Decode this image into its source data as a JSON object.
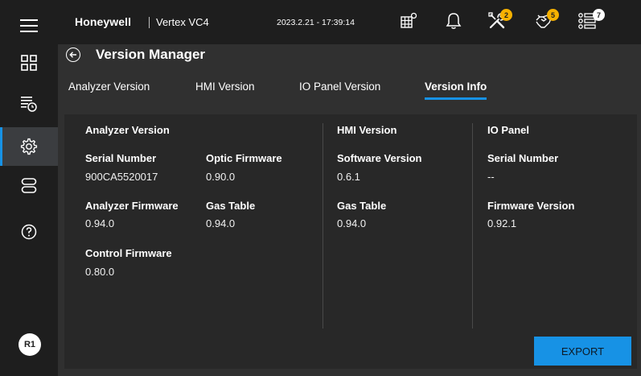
{
  "header": {
    "brand": "Honeywell",
    "product": "Vertex VC4",
    "datetime": "2023.2.21 - 17:39:14",
    "icons": [
      {
        "name": "sensor-grid-icon",
        "badge": ""
      },
      {
        "name": "bell-icon",
        "badge": ""
      },
      {
        "name": "tools-icon",
        "badge": "2"
      },
      {
        "name": "hand-icon",
        "badge": "5"
      },
      {
        "name": "list-icon",
        "badge": "7"
      }
    ]
  },
  "sidebar": {
    "items": [
      {
        "name": "menu-icon",
        "active": false
      },
      {
        "name": "dashboard-icon",
        "active": false
      },
      {
        "name": "schedule-list-icon",
        "active": false
      },
      {
        "name": "settings-icon",
        "active": true
      },
      {
        "name": "storage-icon",
        "active": false
      },
      {
        "name": "help-icon",
        "active": false
      }
    ],
    "user_initials": "R1"
  },
  "page": {
    "title": "Version Manager"
  },
  "tabs": [
    {
      "label": "Analyzer Version",
      "active": false
    },
    {
      "label": "HMI Version",
      "active": false
    },
    {
      "label": "IO Panel Version",
      "active": false
    },
    {
      "label": "Version Info",
      "active": true
    }
  ],
  "analyzer": {
    "title": "Analyzer Version",
    "serial_label": "Serial Number",
    "serial_value": "900CA5520017",
    "optic_label": "Optic Firmware",
    "optic_value": "0.90.0",
    "firmware_label": "Analyzer Firmware",
    "firmware_value": "0.94.0",
    "gas_label": "Gas Table",
    "gas_value": "0.94.0",
    "control_label": "Control Firmware",
    "control_value": "0.80.0"
  },
  "hmi": {
    "title": "HMI Version",
    "software_label": "Software Version",
    "software_value": "0.6.1",
    "gas_label": "Gas Table",
    "gas_value": "0.94.0"
  },
  "io_panel": {
    "title": "IO Panel",
    "serial_label": "Serial Number",
    "serial_value": "--",
    "firmware_label": "Firmware Version",
    "firmware_value": "0.92.1"
  },
  "actions": {
    "export_label": "EXPORT"
  },
  "colors": {
    "accent": "#1792e5",
    "badge": "#f6b100",
    "background": "#1e1e1e",
    "panel": "#303030"
  }
}
